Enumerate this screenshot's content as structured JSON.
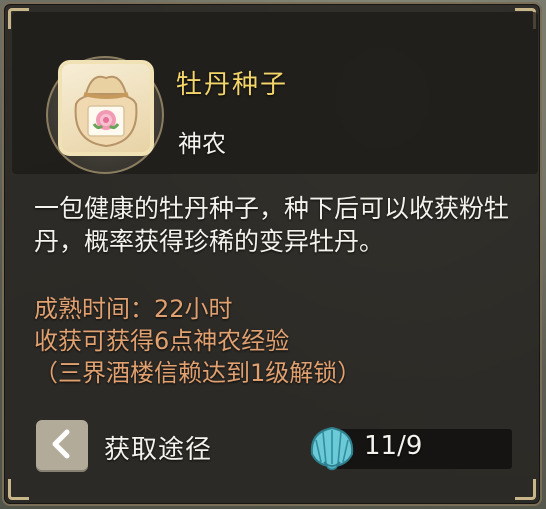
{
  "item": {
    "name": "牡丹种子",
    "type": "神农",
    "icon": "peony-seed-bag-icon"
  },
  "description": "一包健康的牡丹种子，种下后可以收获粉牡丹，概率获得珍稀的变异牡丹。",
  "stats": {
    "grow_time": "成熟时间：22小时",
    "exp": "收获可获得6点神农经验",
    "unlock": "（三界酒楼信赖达到1级解锁）"
  },
  "footer": {
    "back_icon": "chevron-left-icon",
    "source_label": "获取途径",
    "currency_icon": "shell-icon",
    "count": "11/9"
  },
  "colors": {
    "name": "#f3d56a",
    "stats": "#e0a070",
    "text": "#f4f2ec"
  }
}
